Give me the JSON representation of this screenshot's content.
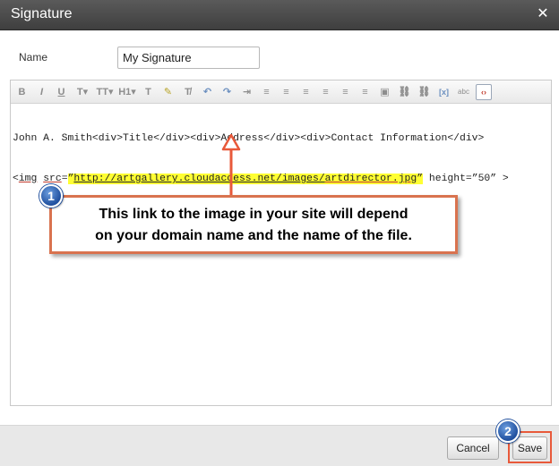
{
  "dialog": {
    "title": "Signature",
    "close_glyph": "✕"
  },
  "form": {
    "name_label": "Name",
    "name_value": "My Signature"
  },
  "toolbar": {
    "items": [
      {
        "name": "bold-icon",
        "glyph": "B"
      },
      {
        "name": "italic-icon",
        "glyph": "I"
      },
      {
        "name": "underline-icon",
        "glyph": "U"
      },
      {
        "name": "font-style-icon",
        "glyph": "T▾"
      },
      {
        "name": "font-size-icon",
        "glyph": "TT▾"
      },
      {
        "name": "heading-icon",
        "glyph": "H1▾"
      },
      {
        "name": "text-color-icon",
        "glyph": "T"
      },
      {
        "name": "highlight-icon",
        "glyph": "✎"
      },
      {
        "name": "clear-format-icon",
        "glyph": "T̸"
      },
      {
        "name": "undo-icon",
        "glyph": "↶"
      },
      {
        "name": "redo-icon",
        "glyph": "↷"
      },
      {
        "name": "indent-icon",
        "glyph": "⇥"
      },
      {
        "name": "numbered-list-icon",
        "glyph": "≡"
      },
      {
        "name": "bullet-list-icon",
        "glyph": "≡"
      },
      {
        "name": "align-left-icon",
        "glyph": "≡"
      },
      {
        "name": "align-center-icon",
        "glyph": "≡"
      },
      {
        "name": "align-right-icon",
        "glyph": "≡"
      },
      {
        "name": "align-justify-icon",
        "glyph": "≡"
      },
      {
        "name": "image-icon",
        "glyph": "▣"
      },
      {
        "name": "link-icon",
        "glyph": "⛓"
      },
      {
        "name": "unlink-icon",
        "glyph": "⛓"
      },
      {
        "name": "variable-icon",
        "glyph": "[x]"
      },
      {
        "name": "spellcheck-icon",
        "glyph": "abc"
      }
    ],
    "source_glyph": "‹›"
  },
  "editor": {
    "line1": "John A. Smith<div>Title</div><div>Address</div><div>Contact Information</div>",
    "line2_pre": "<",
    "line2_img": "img",
    "line2_sp": " ",
    "line2_src": "src",
    "line2_eq": "=",
    "line2_q1": "”",
    "line2_url_a": "http://artgallery.cloudaccess.net/images/",
    "line2_url_b": "artdirector.jpg",
    "line2_q2": "”",
    "line2_post": " height=”50” >"
  },
  "callout": {
    "badge1": "1",
    "line1": "This link to the image in your site will depend",
    "line2": "on your domain name and the name of the file.",
    "badge2": "2"
  },
  "footer": {
    "cancel_label": "Cancel",
    "save_label": "Save"
  },
  "colors": {
    "titlebar": "#4a4a4a",
    "annotation": "#e8593a",
    "highlight": "#ffff33",
    "badge": "#1f4f9e"
  }
}
